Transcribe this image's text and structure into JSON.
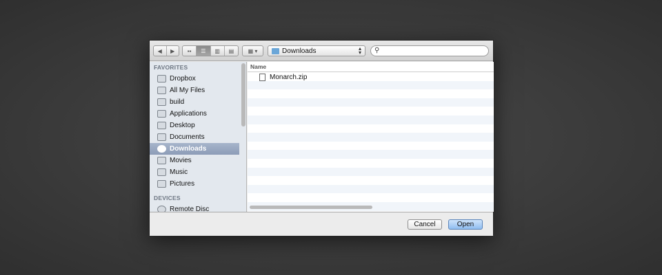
{
  "toolbar": {
    "back": "◀",
    "forward": "▶",
    "views": [
      "icon-view",
      "list-view",
      "column-view",
      "coverflow-view"
    ],
    "arrange": "▦ ▾",
    "location": "Downloads",
    "search_placeholder": ""
  },
  "sidebar": {
    "favorites_label": "FAVORITES",
    "favorites": [
      {
        "label": "Dropbox"
      },
      {
        "label": "All My Files"
      },
      {
        "label": "build"
      },
      {
        "label": "Applications"
      },
      {
        "label": "Desktop"
      },
      {
        "label": "Documents"
      },
      {
        "label": "Downloads",
        "selected": true
      },
      {
        "label": "Movies"
      },
      {
        "label": "Music"
      },
      {
        "label": "Pictures"
      }
    ],
    "devices_label": "DEVICES",
    "devices": [
      {
        "label": "Remote Disc"
      }
    ]
  },
  "content": {
    "column_name": "Name",
    "files": [
      {
        "name": "Monarch.zip"
      }
    ]
  },
  "buttons": {
    "cancel": "Cancel",
    "open": "Open"
  }
}
